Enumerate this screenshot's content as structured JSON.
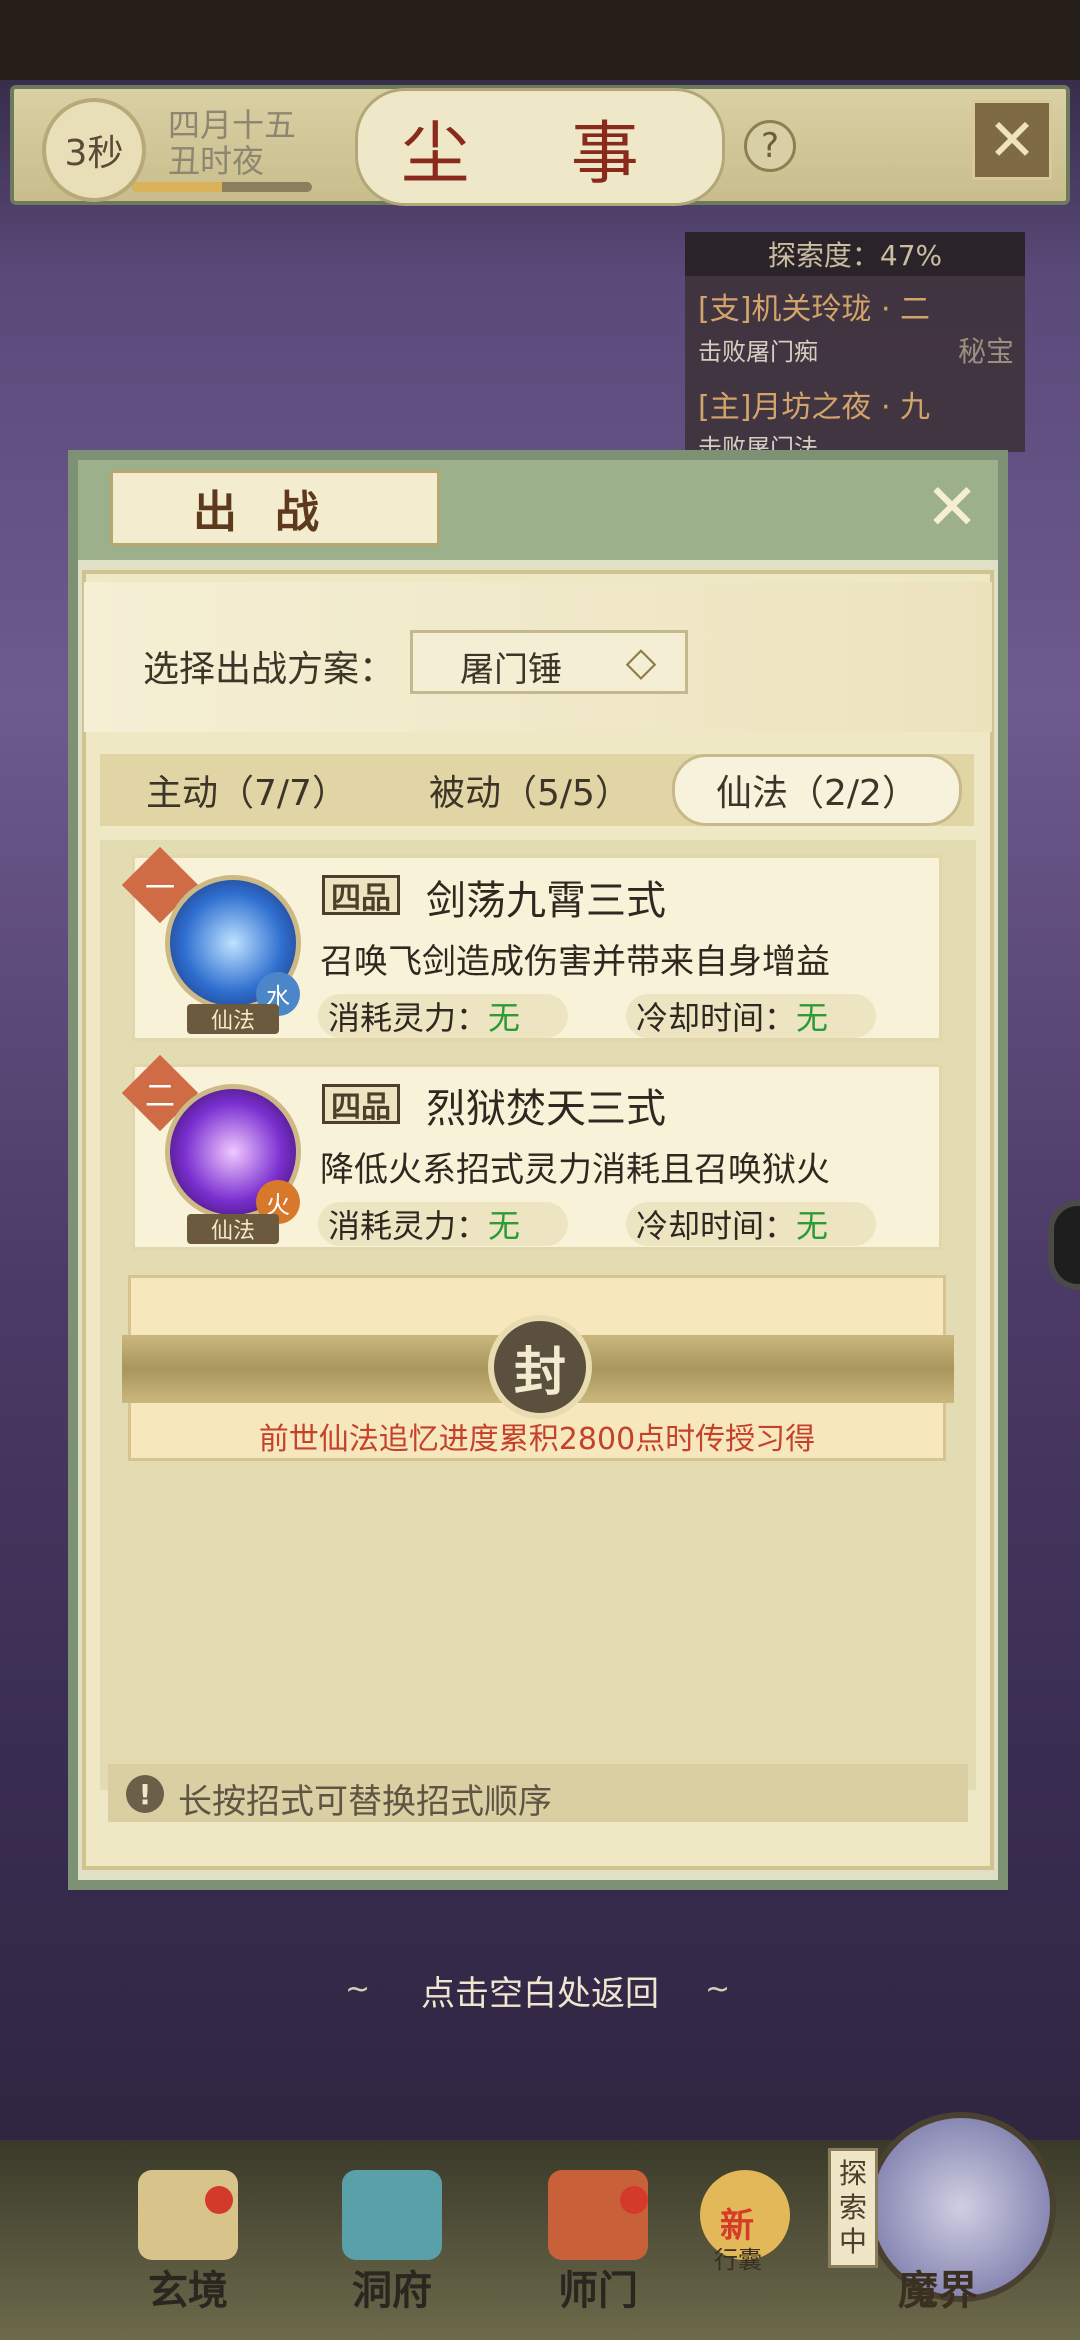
{
  "header": {
    "timer": "3秒",
    "date_line1": "四月十五",
    "date_line2": "丑时夜",
    "timer_progress": 0.5,
    "title": "尘 事",
    "help_icon": "?",
    "close_icon": "✕"
  },
  "quest_panel": {
    "explore_label": "探索度：47%",
    "quests": [
      {
        "title": "[支]机关玲珑 · 二",
        "sub": "击败屠门痴",
        "tag": "秘宝"
      },
      {
        "title": "[主]月坊之夜 · 九",
        "sub": "击败屠门法"
      }
    ]
  },
  "dialog": {
    "title": "出战",
    "close_icon": "✕",
    "scheme_label": "选择出战方案：",
    "scheme_value": "屠门锤",
    "scheme_arrow_icon": "◇",
    "tabs": [
      {
        "label": "主动（7/7）",
        "active": false
      },
      {
        "label": "被动（5/5）",
        "active": false
      },
      {
        "label": "仙法（2/2）",
        "active": true
      }
    ],
    "skills": [
      {
        "order": "一",
        "grade": "四品",
        "name": "剑荡九霄三式",
        "description": "召唤飞剑造成伤害并带来自身增益",
        "cost_label": "消耗灵力：",
        "cost_value": "无",
        "cooldown_label": "冷却时间：",
        "cooldown_value": "无",
        "element": "水",
        "type_tag": "仙法",
        "colors": {
          "icon": "#2f6fd0",
          "element": "#4a86c8"
        }
      },
      {
        "order": "二",
        "grade": "四品",
        "name": "烈狱焚天三式",
        "description": "降低火系招式灵力消耗且召唤狱火",
        "cost_label": "消耗灵力：",
        "cost_value": "无",
        "cooldown_label": "冷却时间：",
        "cooldown_value": "无",
        "element": "火",
        "type_tag": "仙法",
        "colors": {
          "icon": "#7a2fd0",
          "element": "#d8782a"
        }
      }
    ],
    "sealed": {
      "emblem": "封",
      "text": "前世仙法追忆进度累积2800点时传授习得"
    },
    "hint_icon": "!",
    "hint": "长按招式可替换招式顺序"
  },
  "back_hint": "点击空白处返回",
  "bottom_nav": {
    "items": [
      "玄境",
      "洞府",
      "师门",
      "魔界"
    ],
    "bag_new": "新",
    "bag_label": "行囊",
    "explore_tag": [
      "探",
      "索",
      "中"
    ]
  },
  "colors": {
    "accent_red": "#c6412b",
    "value_green": "#2f9a35",
    "frame_green": "#7d9275"
  }
}
